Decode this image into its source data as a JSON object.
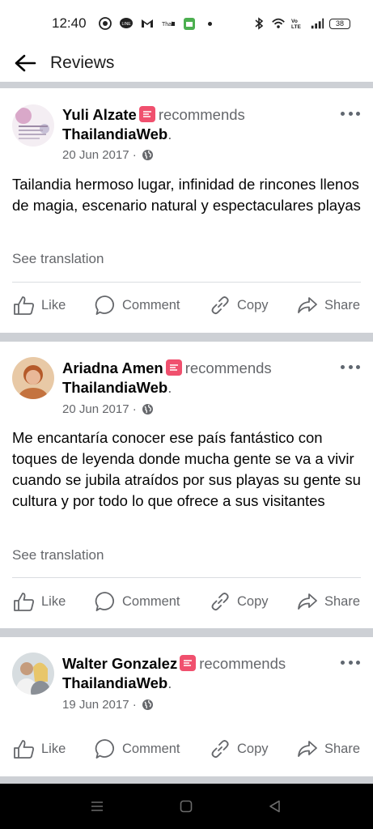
{
  "status_bar": {
    "time": "12:40",
    "battery": "38",
    "left_icons": [
      "whatsapp-icon",
      "line-icon",
      "gmail-icon",
      "thai-news-icon",
      "calendar-icon"
    ],
    "right_icons": [
      "bluetooth-icon",
      "wifi-icon",
      "volte-icon",
      "signal-icon",
      "battery-icon"
    ]
  },
  "header": {
    "title": "Reviews",
    "back_icon": "arrow-left-icon"
  },
  "posts": [
    {
      "author": "Yuli Alzate",
      "verb": "recommends",
      "page": "ThailandiaWeb",
      "date": "20 Jun 2017 · ",
      "text": "Tailandia hermoso lugar, infinidad de rincones llenos de magia, escenario natural y espectaculares playas",
      "see_translation": "See translation"
    },
    {
      "author": "Ariadna Amen",
      "verb": "recommends",
      "page": "ThailandiaWeb",
      "date": "20 Jun 2017 · ",
      "text": "Me encantaría conocer ese país fantástico con toques de leyenda donde mucha gente se va a vivir cuando se jubila atraídos por sus playas su gente su cultura y por todo lo que ofrece a sus visitantes",
      "see_translation": "See translation"
    },
    {
      "author": "Walter Gonzalez",
      "verb": "recommends",
      "page": "ThailandiaWeb",
      "date": "19 Jun 2017 · "
    }
  ],
  "actions": {
    "like": "Like",
    "comment": "Comment",
    "copy": "Copy",
    "share": "Share"
  },
  "colors": {
    "badge": "#f0506e",
    "secondary_text": "#65676b",
    "divider": "#cdd0d5"
  }
}
